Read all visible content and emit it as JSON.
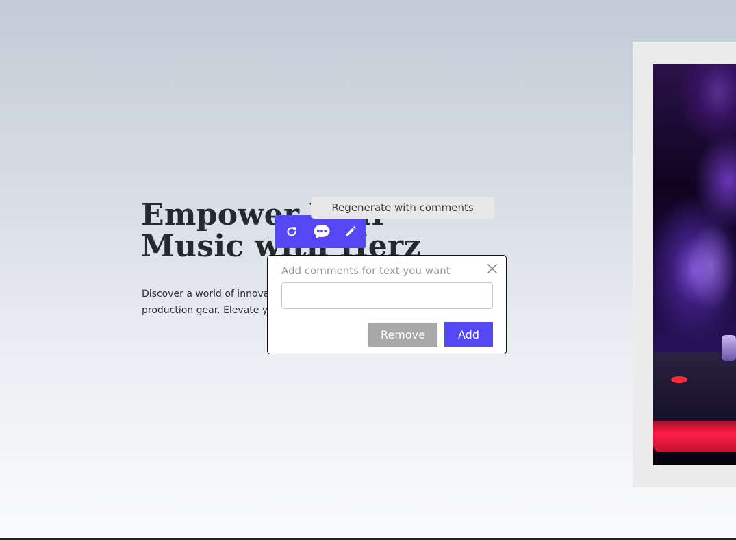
{
  "hero": {
    "title_line1": "Empower Your",
    "title_line2": "Music with Herz",
    "description_line1": "Discover a world of innovative audio",
    "description_line2": "production gear. Elevate your sound"
  },
  "toolbar": {
    "regenerate_icon": "refresh-icon",
    "comment_icon": "comment-bubble-icon",
    "edit_icon": "pencil-icon",
    "accent_color": "#5548f4"
  },
  "tooltip": {
    "text": "Regenerate with comments"
  },
  "comment_popup": {
    "label": "Add comments for text you want",
    "input_value": "",
    "close_icon": "close-icon",
    "remove_label": "Remove",
    "add_label": "Add"
  }
}
